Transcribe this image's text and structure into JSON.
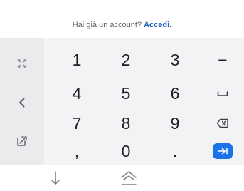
{
  "signup": {
    "prompt_text": "Hai già un account?",
    "login_link": "Accedi."
  },
  "keyboard": {
    "rows": [
      [
        "1",
        "2",
        "3"
      ],
      [
        "4",
        "5",
        "6"
      ],
      [
        "7",
        "8",
        "9"
      ],
      [
        ",",
        "0",
        "."
      ]
    ],
    "side_keys": {
      "minus": "−",
      "space": "space-icon",
      "backspace": "backspace-icon",
      "enter": "tab-arrow-icon"
    },
    "tool_keys": [
      "expand-keyboard-icon",
      "chevron-left-icon",
      "edit-text-icon"
    ],
    "accent_color": "#1a73e8"
  },
  "navigation": {
    "buttons": [
      "hide-keyboard-icon",
      "home-icon"
    ]
  }
}
